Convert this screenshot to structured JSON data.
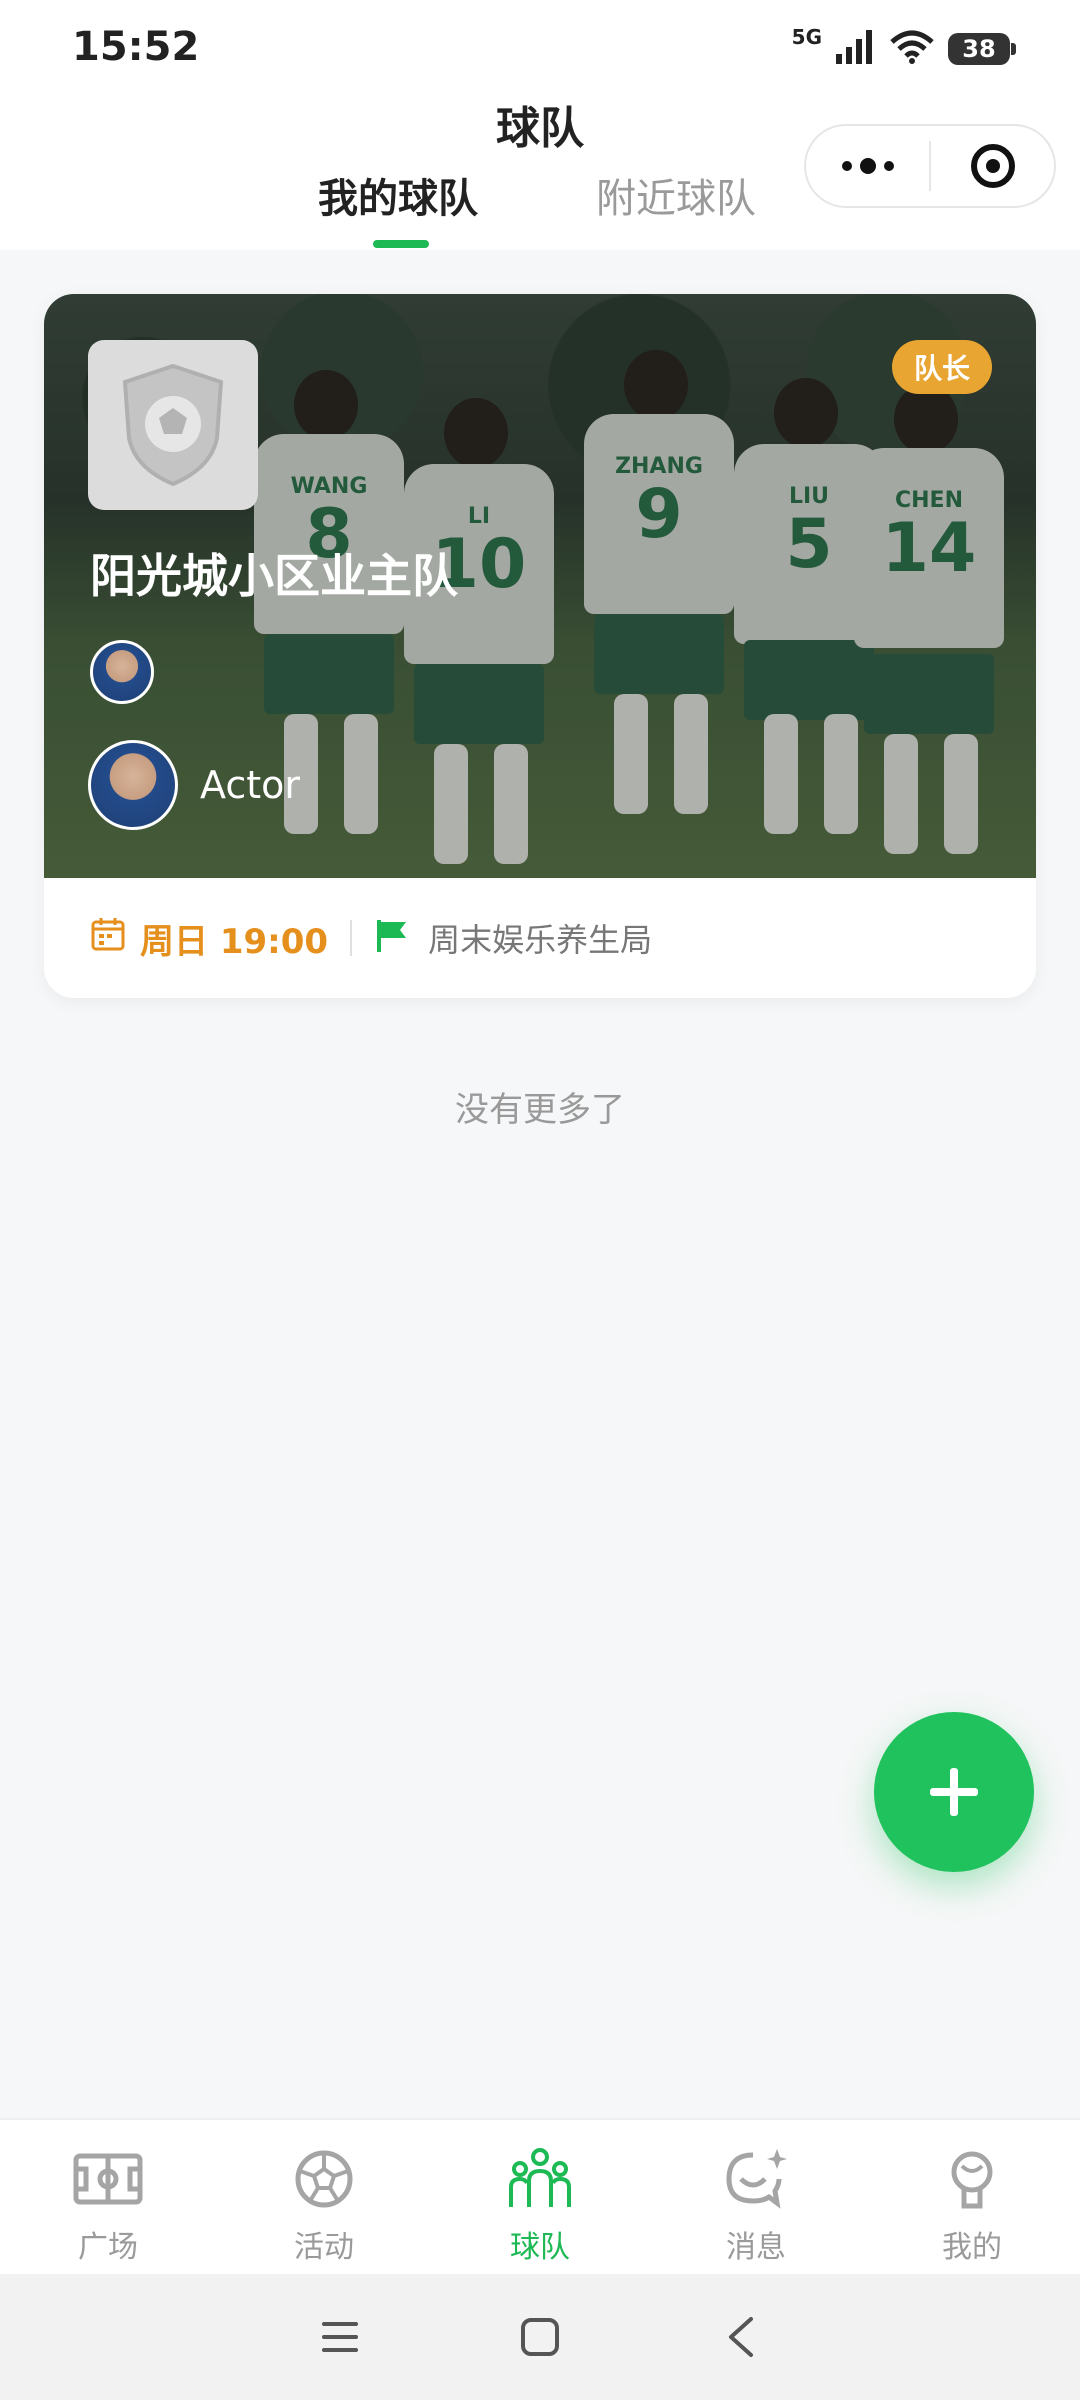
{
  "status_bar": {
    "time": "15:52",
    "network": "5G",
    "battery": "38"
  },
  "header": {
    "title": "球队",
    "tabs": [
      {
        "label": "我的球队",
        "active": true
      },
      {
        "label": "附近球队",
        "active": false
      }
    ],
    "more_icon": "more-dots-icon",
    "close_icon": "target-icon"
  },
  "team_card": {
    "name": "阳光城小区业主队",
    "role_badge": "队长",
    "member_name": "Actor",
    "schedule": "周日 19:00",
    "type": "周末娱乐养生局",
    "players": [
      {
        "name": "WANG",
        "number": "8"
      },
      {
        "name": "LI",
        "number": "10"
      },
      {
        "name": "ZHANG",
        "number": "9"
      },
      {
        "name": "LIU",
        "number": "5"
      },
      {
        "name": "CHEN",
        "number": "14"
      }
    ]
  },
  "list_footer": "没有更多了",
  "bottom_nav": [
    {
      "label": "广场",
      "icon": "field-icon",
      "active": false
    },
    {
      "label": "活动",
      "icon": "soccer-ball-icon",
      "active": false
    },
    {
      "label": "球队",
      "icon": "team-icon",
      "active": true
    },
    {
      "label": "消息",
      "icon": "message-icon",
      "active": false
    },
    {
      "label": "我的",
      "icon": "profile-icon",
      "active": false
    }
  ],
  "colors": {
    "accent": "#1db954",
    "badge": "#e8a531",
    "schedule": "#e58f1d"
  }
}
